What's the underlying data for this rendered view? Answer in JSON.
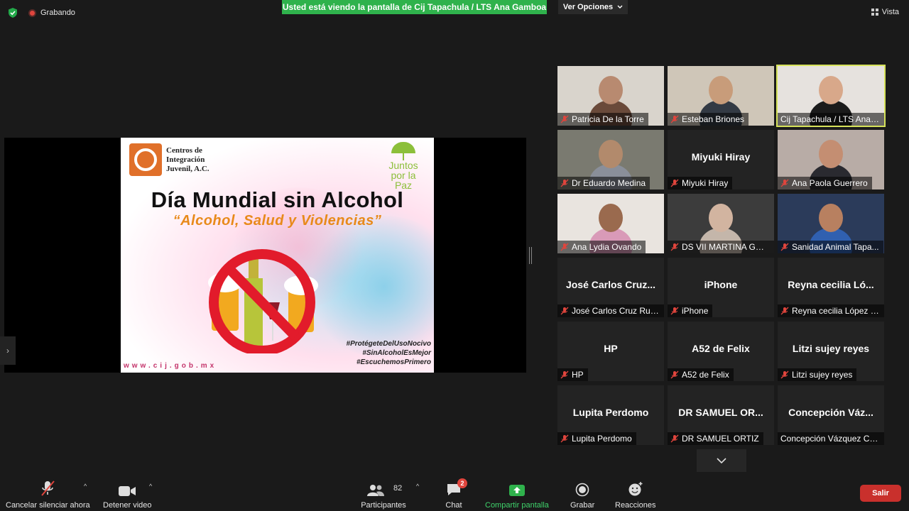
{
  "top_bar": {
    "recording_label": "Grabando",
    "sharing_banner": "Usted está viendo la pantalla de Cij Tapachula / LTS Ana Gamboa",
    "view_options_label": "Ver Opciones",
    "view_label": "Vista"
  },
  "slide": {
    "org_line1": "Centros de",
    "org_line2": "Integración",
    "org_line3": "Juvenil, A.C.",
    "juntos_line1": "Juntos",
    "juntos_line2": "por la",
    "juntos_line3": "Paz",
    "title": "Día Mundial sin Alcohol",
    "subtitle": "“Alcohol, Salud y Violencias”",
    "hashtag1": "#ProtégeteDelUsoNocivo",
    "hashtag2": "#SinAlcoholEsMejor",
    "hashtag3": "#EscuchemosPrimero",
    "url": "www.cij.gob.mx"
  },
  "participants": [
    {
      "name": "Patricia De la Torre",
      "center": "",
      "video": true,
      "muted": true
    },
    {
      "name": "Esteban Briones",
      "center": "",
      "video": true,
      "muted": true
    },
    {
      "name": "Cij Tapachula / LTS Ana ...",
      "center": "",
      "video": true,
      "muted": false,
      "active": true
    },
    {
      "name": "Dr Eduardo Medina",
      "center": "",
      "video": true,
      "muted": true
    },
    {
      "name": "Miyuki Hiray",
      "center": "Miyuki Hiray",
      "video": false,
      "muted": true
    },
    {
      "name": "Ana Paola Guerrero",
      "center": "",
      "video": true,
      "muted": true
    },
    {
      "name": "Ana Lydia Ovando",
      "center": "",
      "video": true,
      "muted": true
    },
    {
      "name": "DS VII MARTINA GRA...",
      "center": "",
      "video": true,
      "muted": true
    },
    {
      "name": "Sanidad Animal Tapa...",
      "center": "",
      "video": true,
      "muted": true
    },
    {
      "name": "José Carlos Cruz Ruiz...",
      "center": "José Carlos Cruz...",
      "video": false,
      "muted": true
    },
    {
      "name": "iPhone",
      "center": "iPhone",
      "video": false,
      "muted": true
    },
    {
      "name": "Reyna cecilia López ci...",
      "center": "Reyna cecilia Ló...",
      "video": false,
      "muted": true
    },
    {
      "name": "HP",
      "center": "HP",
      "video": false,
      "muted": true
    },
    {
      "name": "A52 de Felix",
      "center": "A52 de Felix",
      "video": false,
      "muted": true
    },
    {
      "name": "Litzi sujey reyes",
      "center": "Litzi sujey reyes",
      "video": false,
      "muted": true
    },
    {
      "name": "Lupita Perdomo",
      "center": "Lupita Perdomo",
      "video": false,
      "muted": true
    },
    {
      "name": "DR SAMUEL ORTIZ",
      "center": "DR SAMUEL OR...",
      "video": false,
      "muted": true
    },
    {
      "name": "Concepción Vázquez Cruz",
      "center": "Concepción Váz...",
      "video": false,
      "muted": false
    }
  ],
  "toolbar": {
    "mute_label": "Cancelar silenciar ahora",
    "video_label": "Detener video",
    "participants_label": "Participantes",
    "participants_count": "82",
    "chat_label": "Chat",
    "chat_badge": "2",
    "share_label": "Compartir pantalla",
    "record_label": "Grabar",
    "reactions_label": "Reacciones",
    "leave_label": "Salir"
  },
  "colors": {
    "banner_green": "#2fb24c",
    "active_speaker": "#d6e25a",
    "leave_red": "#c9302c",
    "share_green": "#3fd36b"
  }
}
